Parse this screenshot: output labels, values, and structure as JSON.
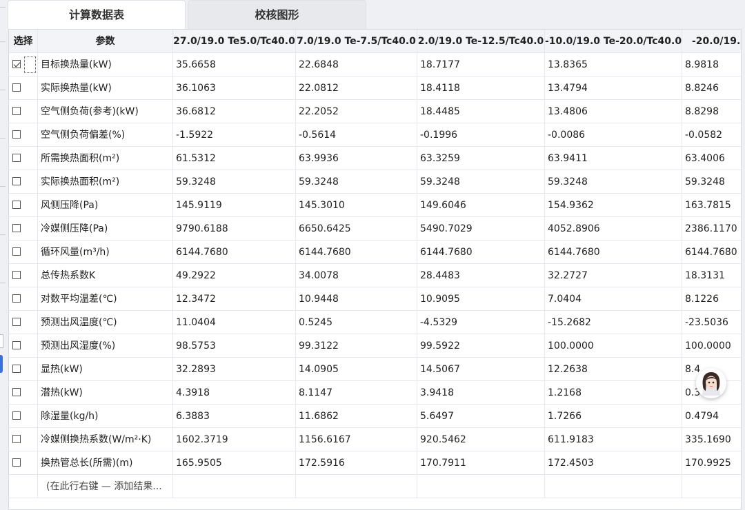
{
  "tabs": [
    {
      "label": "计算数据表",
      "active": true
    },
    {
      "label": "校核图形",
      "active": false
    }
  ],
  "table": {
    "headers": {
      "select": "选择",
      "param": "参数",
      "conditions": [
        "27.0/19.0 Te5.0/Tc40.0",
        "7.0/19.0 Te-7.5/Tc40.0",
        "2.0/19.0 Te-12.5/Tc40.0",
        "-10.0/19.0 Te-20.0/Tc40.0",
        "-20.0/19.0"
      ]
    },
    "rows": [
      {
        "checked": true,
        "param": "目标换热量(kW)",
        "values": [
          "35.6658",
          "22.6848",
          "18.7177",
          "13.8365",
          "8.9818"
        ]
      },
      {
        "checked": false,
        "param": "实际换热量(kW)",
        "values": [
          "36.1063",
          "22.0812",
          "18.4118",
          "13.4794",
          "8.8246"
        ]
      },
      {
        "checked": false,
        "param": "空气侧负荷(参考)(kW)",
        "values": [
          "36.6812",
          "22.2052",
          "18.4485",
          "13.4806",
          "8.8298"
        ]
      },
      {
        "checked": false,
        "param": "空气侧负荷偏差(%)",
        "values": [
          "-1.5922",
          "-0.5614",
          "-0.1996",
          "-0.0086",
          "-0.0582"
        ]
      },
      {
        "checked": false,
        "param": "所需换热面积(m²)",
        "values": [
          "61.5312",
          "63.9936",
          "63.3259",
          "63.9411",
          "63.4006"
        ]
      },
      {
        "checked": false,
        "param": "实际换热面积(m²)",
        "values": [
          "59.3248",
          "59.3248",
          "59.3248",
          "59.3248",
          "59.3248"
        ]
      },
      {
        "checked": false,
        "param": "风侧压降(Pa)",
        "values": [
          "145.9119",
          "145.3010",
          "149.6046",
          "154.9362",
          "163.7815"
        ]
      },
      {
        "checked": false,
        "param": "冷媒侧压降(Pa)",
        "values": [
          "9790.6188",
          "6650.6425",
          "5490.7029",
          "4052.8906",
          "2386.1170"
        ]
      },
      {
        "checked": false,
        "param": "循环风量(m³/h)",
        "values": [
          "6144.7680",
          "6144.7680",
          "6144.7680",
          "6144.7680",
          "6144.7680"
        ]
      },
      {
        "checked": false,
        "param": "总传热系数K",
        "values": [
          "49.2922",
          "34.0078",
          "28.4483",
          "32.2727",
          "18.3131"
        ]
      },
      {
        "checked": false,
        "param": "对数平均温差(℃)",
        "values": [
          "12.3472",
          "10.9448",
          "10.9095",
          "7.0404",
          "8.1226"
        ]
      },
      {
        "checked": false,
        "param": "预测出风温度(℃)",
        "values": [
          "11.0404",
          "0.5245",
          "-4.5329",
          "-15.2682",
          "-23.5036"
        ]
      },
      {
        "checked": false,
        "param": "预测出风湿度(%)",
        "values": [
          "98.5753",
          "99.3122",
          "99.5922",
          "100.0000",
          "100.0000"
        ]
      },
      {
        "checked": false,
        "param": "显热(kW)",
        "values": [
          "32.2893",
          "14.0905",
          "14.5067",
          "12.2638",
          "8.4"
        ]
      },
      {
        "checked": false,
        "param": "潜热(kW)",
        "values": [
          "4.3918",
          "8.1147",
          "3.9418",
          "1.2168",
          "0.3404"
        ]
      },
      {
        "checked": false,
        "param": "除湿量(kg/h)",
        "values": [
          "6.3883",
          "11.6862",
          "5.6497",
          "1.7266",
          "0.4794"
        ]
      },
      {
        "checked": false,
        "param": "冷媒侧换热系数(W/m²·K)",
        "values": [
          "1602.3719",
          "1156.6167",
          "920.5462",
          "611.9183",
          "335.1690"
        ]
      },
      {
        "checked": false,
        "param": "换热管总长(所需)(m)",
        "values": [
          "165.9505",
          "172.5916",
          "170.7911",
          "172.4503",
          "170.9925"
        ]
      }
    ],
    "add_row_hint": "(在此行右键 — 添加结果..."
  },
  "assistant": {
    "icon": "assistant-avatar-icon"
  }
}
